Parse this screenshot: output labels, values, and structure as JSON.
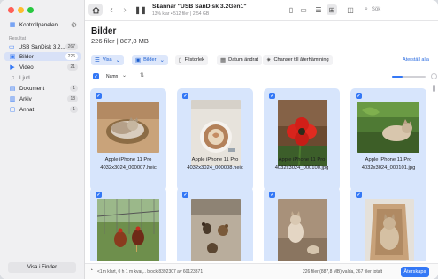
{
  "sidebar": {
    "app_title": "Kontrollpanelen",
    "section_label": "Resultat",
    "items": [
      {
        "label": "USB  SanDisk 3.2...",
        "count": "267",
        "icon": "drive-icon"
      },
      {
        "label": "Bilder",
        "count": "226",
        "icon": "photo-icon"
      },
      {
        "label": "Video",
        "count": "21",
        "icon": "video-icon"
      },
      {
        "label": "Ljud",
        "count": "",
        "icon": "music-icon"
      },
      {
        "label": "Dokument",
        "count": "1",
        "icon": "document-icon"
      },
      {
        "label": "Arkiv",
        "count": "18",
        "icon": "archive-icon"
      },
      {
        "label": "Annat",
        "count": "1",
        "icon": "other-icon"
      }
    ],
    "finder_button": "Visa i Finder"
  },
  "toolbar": {
    "title": "Skannar \"USB  SanDisk 3.2Gen1\"",
    "subtitle": "13% klar • 512 filer | 2,54 GB",
    "search_placeholder": "Sök"
  },
  "header": {
    "title": "Bilder",
    "subtitle": "226 filer | 887,8 MB"
  },
  "filters": {
    "view": "Visa",
    "type": "Bilder",
    "size": "Filstorlek",
    "date": "Datum ändrat",
    "chance": "Chanser till återhämtning",
    "reset": "Återställ alla"
  },
  "columns": {
    "name": "Namn"
  },
  "files": [
    {
      "name": "Apple iPhone 11 Pro",
      "file": "4032x3024_000007.heic"
    },
    {
      "name": "Apple iPhone 11 Pro",
      "file": "4032x3024_000008.heic"
    },
    {
      "name": "Apple iPhone 11 Pro",
      "file": "4032x3024_000100.jpg"
    },
    {
      "name": "Apple iPhone 11 Pro",
      "file": "4032x3024_000101.jpg"
    },
    {
      "name": "",
      "file": ""
    },
    {
      "name": "",
      "file": ""
    },
    {
      "name": "",
      "file": ""
    },
    {
      "name": "",
      "file": ""
    }
  ],
  "status": {
    "progress": "<1m klart, 0 h 1 m kvar,.. block 8392307 av 60123371",
    "selection": "226 filer (887,8 MB) valda, 267 filer totalt",
    "restore_button": "Återskapa"
  },
  "colors": {
    "accent": "#3478f6",
    "tile_selected": "#d7e5fc"
  }
}
